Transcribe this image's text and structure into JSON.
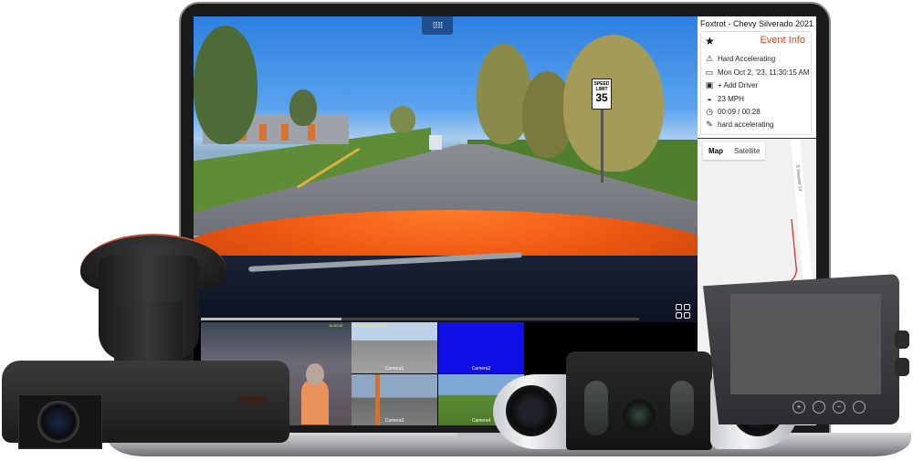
{
  "side_panel": {
    "vehicle_title": "Foxtrot - Chevy Silverado 2021",
    "event_info": {
      "favorite_icon": "star-icon",
      "title": "Event Info",
      "title_color": "#e4401f",
      "rows": [
        {
          "icon": "warning-icon",
          "glyph": "⚠",
          "text": "Hard Accelerating"
        },
        {
          "icon": "calendar-icon",
          "glyph": "▭",
          "text": "Mon Oct 2, '23, 11:30:15 AM"
        },
        {
          "icon": "driver-badge-icon",
          "glyph": "▣",
          "text": "+ Add Driver"
        },
        {
          "icon": "speedometer-icon",
          "glyph": "◒",
          "text": "23 MPH"
        },
        {
          "icon": "stopwatch-icon",
          "glyph": "◷",
          "text": "00:09 / 00:28"
        },
        {
          "icon": "pencil-icon",
          "glyph": "✎",
          "text": "hard accelerating"
        }
      ]
    },
    "map": {
      "tabs": [
        {
          "label": "Map",
          "active": true
        },
        {
          "label": "Satellite",
          "active": false
        }
      ],
      "street_label": "S Shearer Dr",
      "route_color": "#e0201a"
    }
  },
  "video": {
    "grid_toggle_glyph": "⠿⠿",
    "speed_sign": {
      "top": "SPEED",
      "middle": "LIMIT",
      "value": "35"
    },
    "playback_progress": 0.32,
    "thumbnails": [
      {
        "label": "",
        "timestamp": "11:30:15"
      },
      {
        "label": "Camera1",
        "timestamp": "2023/10/02 11:30:15"
      },
      {
        "label": "Camera2",
        "timestamp": ""
      },
      {
        "label": "Camera3",
        "timestamp": ""
      },
      {
        "label": "Camera4",
        "timestamp": ""
      }
    ]
  },
  "colors": {
    "grid_toggle_bg": "#1f4f8c",
    "camera2_blue": "#1010e6",
    "hood_orange": "#f05a12"
  }
}
